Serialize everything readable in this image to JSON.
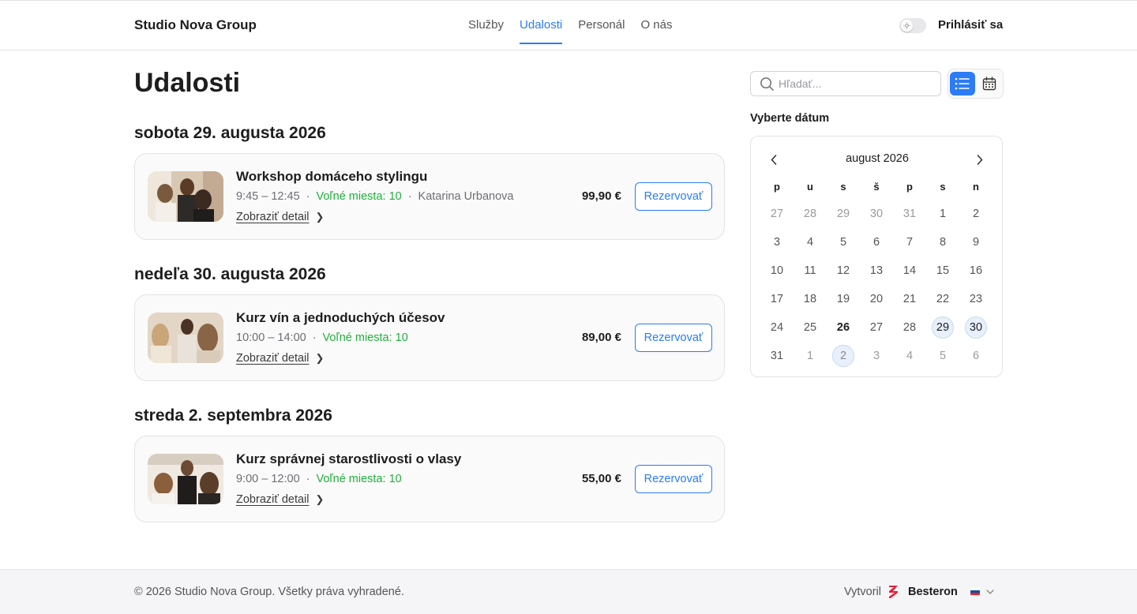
{
  "header": {
    "brand": "Studio Nova Group",
    "nav": [
      {
        "label": "Služby",
        "active": false
      },
      {
        "label": "Udalosti",
        "active": true
      },
      {
        "label": "Personál",
        "active": false
      },
      {
        "label": "O nás",
        "active": false
      }
    ],
    "theme_toggle_icon": "sun-icon",
    "login_label": "Prihlásiť sa"
  },
  "main": {
    "title": "Udalosti",
    "days": [
      {
        "heading": "sobota 29. augusta 2026",
        "event": {
          "title": "Workshop domáceho stylingu",
          "time": "9:45 – 12:45",
          "free_spots": "Voľné miesta: 10",
          "instructor": "Katarina Urbanova",
          "detail_label": "Zobraziť detail",
          "price": "99,90 €",
          "reserve_label": "Rezervovať"
        }
      },
      {
        "heading": "nedeľa 30. augusta 2026",
        "event": {
          "title": "Kurz vín a jednoduchých účesov",
          "time": "10:00 – 14:00",
          "free_spots": "Voľné miesta: 10",
          "detail_label": "Zobraziť detail",
          "price": "89,00 €",
          "reserve_label": "Rezervovať"
        }
      },
      {
        "heading": "streda 2. septembra 2026",
        "event": {
          "title": "Kurz správnej starostlivosti o vlasy",
          "time": "9:00 – 12:00",
          "free_spots": "Voľné miesta: 10",
          "detail_label": "Zobraziť detail",
          "price": "55,00 €",
          "reserve_label": "Rezervovať"
        }
      }
    ]
  },
  "sidebar": {
    "search_placeholder": "Hľadať...",
    "view_active": "list",
    "select_date_label": "Vyberte dátum",
    "calendar": {
      "month_label": "august 2026",
      "weekdays": [
        "p",
        "u",
        "s",
        "š",
        "p",
        "s",
        "n"
      ],
      "days": [
        {
          "d": "27",
          "muted": true
        },
        {
          "d": "28",
          "muted": true
        },
        {
          "d": "29",
          "muted": true
        },
        {
          "d": "30",
          "muted": true
        },
        {
          "d": "31",
          "muted": true
        },
        {
          "d": "1"
        },
        {
          "d": "2"
        },
        {
          "d": "3"
        },
        {
          "d": "4"
        },
        {
          "d": "5"
        },
        {
          "d": "6"
        },
        {
          "d": "7"
        },
        {
          "d": "8"
        },
        {
          "d": "9"
        },
        {
          "d": "10"
        },
        {
          "d": "11"
        },
        {
          "d": "12"
        },
        {
          "d": "13"
        },
        {
          "d": "14"
        },
        {
          "d": "15"
        },
        {
          "d": "16"
        },
        {
          "d": "17"
        },
        {
          "d": "18"
        },
        {
          "d": "19"
        },
        {
          "d": "20"
        },
        {
          "d": "21"
        },
        {
          "d": "22"
        },
        {
          "d": "23"
        },
        {
          "d": "24"
        },
        {
          "d": "25"
        },
        {
          "d": "26",
          "today": true
        },
        {
          "d": "27"
        },
        {
          "d": "28"
        },
        {
          "d": "29",
          "event": true
        },
        {
          "d": "30",
          "event": true
        },
        {
          "d": "31"
        },
        {
          "d": "1",
          "muted": true
        },
        {
          "d": "2",
          "muted": true,
          "event": true
        },
        {
          "d": "3",
          "muted": true
        },
        {
          "d": "4",
          "muted": true
        },
        {
          "d": "5",
          "muted": true
        },
        {
          "d": "6",
          "muted": true
        }
      ]
    }
  },
  "footer": {
    "copyright": "© 2026 Studio Nova Group. Všetky práva vyhradené.",
    "made_by": "Vytvoril",
    "made_by_brand": "Besteron",
    "language_flag": "slovak-flag-icon"
  },
  "colors": {
    "accent": "#2b7cf6",
    "free_spots": "#22b03c",
    "besteron_red": "#e4223a"
  }
}
